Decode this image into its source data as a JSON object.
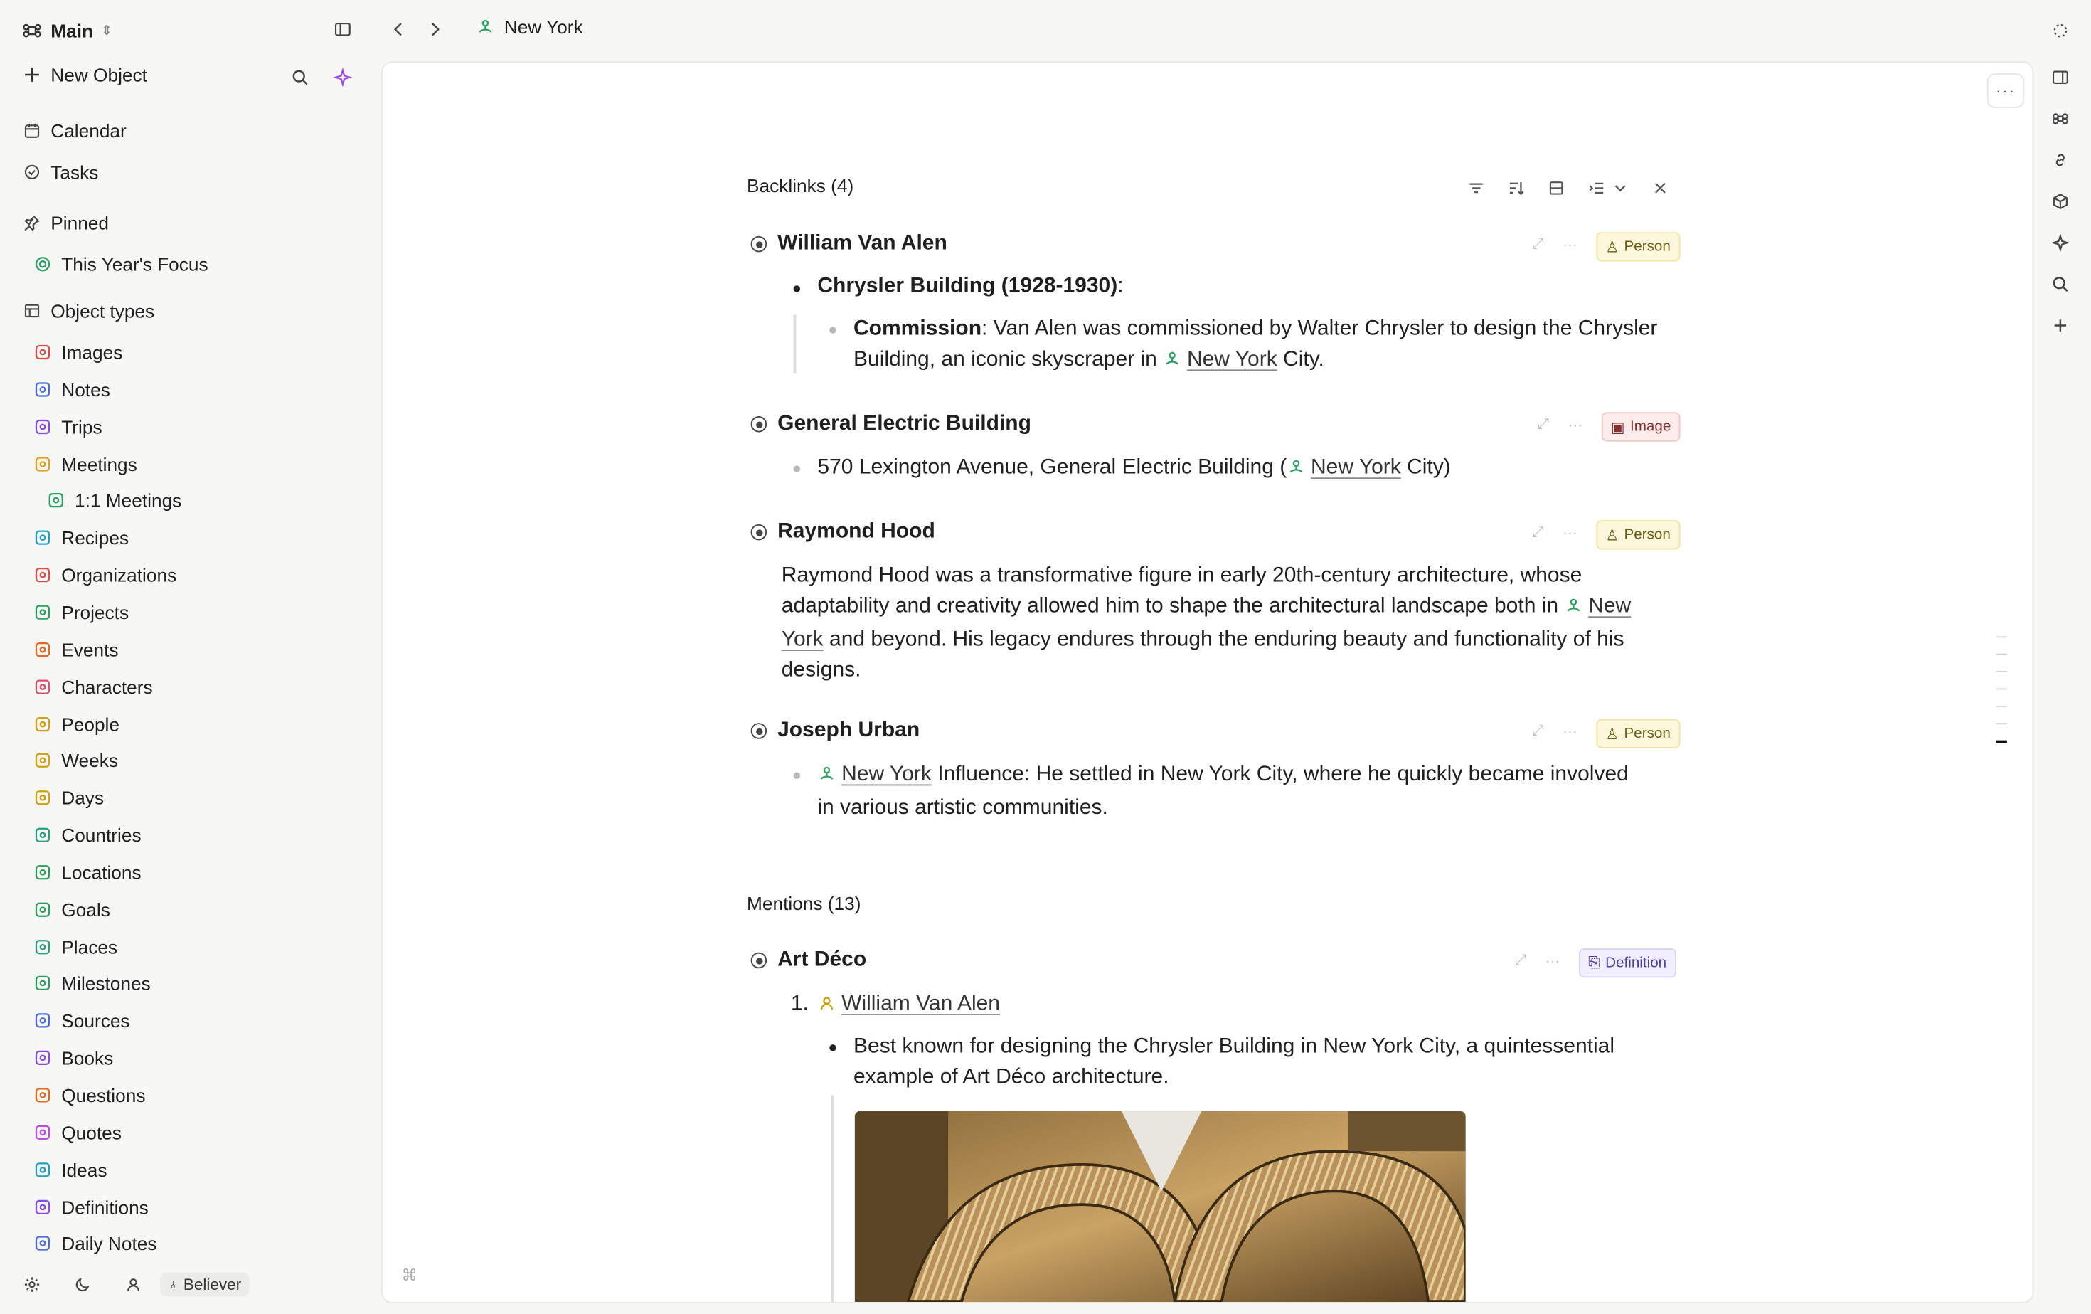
{
  "workspace": {
    "name": "Main"
  },
  "sidebar": {
    "new_object": "New Object",
    "top_items": [
      {
        "label": "Calendar",
        "icon": "calendar-icon"
      },
      {
        "label": "Tasks",
        "icon": "check-circle-icon"
      }
    ],
    "pinned_label": "Pinned",
    "pinned": [
      {
        "label": "This Year's Focus",
        "icon": "target-icon"
      }
    ],
    "object_types_label": "Object types",
    "object_types": [
      {
        "label": "Images",
        "icon": "image-icon",
        "color": "#e04c4c"
      },
      {
        "label": "Notes",
        "icon": "notes-icon",
        "color": "#4c6fe0"
      },
      {
        "label": "Trips",
        "icon": "luggage-icon",
        "color": "#8a4ce0"
      },
      {
        "label": "Meetings",
        "icon": "people-icon",
        "color": "#e0a020"
      },
      {
        "label": "1:1 Meetings",
        "icon": "meeting-list-icon",
        "color": "#2ba060",
        "sub": true
      },
      {
        "label": "Recipes",
        "icon": "chef-hat-icon",
        "color": "#20a0c0"
      },
      {
        "label": "Organizations",
        "icon": "building-icon",
        "color": "#e04c4c"
      },
      {
        "label": "Projects",
        "icon": "cube-icon",
        "color": "#2ba060"
      },
      {
        "label": "Events",
        "icon": "hourglass-icon",
        "color": "#e06a20"
      },
      {
        "label": "Characters",
        "icon": "character-icon",
        "color": "#e04c6a"
      },
      {
        "label": "People",
        "icon": "person-icon",
        "color": "#d0a010"
      },
      {
        "label": "Weeks",
        "icon": "sun-icon",
        "color": "#d0a010"
      },
      {
        "label": "Days",
        "icon": "sun-icon",
        "color": "#d0a010"
      },
      {
        "label": "Countries",
        "icon": "globe-icon",
        "color": "#2ba080"
      },
      {
        "label": "Locations",
        "icon": "location-icon",
        "color": "#2ba060"
      },
      {
        "label": "Goals",
        "icon": "target-icon",
        "color": "#2ba060"
      },
      {
        "label": "Places",
        "icon": "pin-icon",
        "color": "#2ba080"
      },
      {
        "label": "Milestones",
        "icon": "trophy-icon",
        "color": "#2ba060"
      },
      {
        "label": "Sources",
        "icon": "library-icon",
        "color": "#4c6fe0"
      },
      {
        "label": "Books",
        "icon": "book-icon",
        "color": "#8a4ce0"
      },
      {
        "label": "Questions",
        "icon": "question-icon",
        "color": "#e06a20"
      },
      {
        "label": "Quotes",
        "icon": "quote-icon",
        "color": "#c04ce0"
      },
      {
        "label": "Ideas",
        "icon": "bulb-icon",
        "color": "#20a0c0"
      },
      {
        "label": "Definitions",
        "icon": "bookmark-icon",
        "color": "#8a4ce0"
      },
      {
        "label": "Daily Notes",
        "icon": "calendar-icon",
        "color": "#4c6fe0"
      }
    ],
    "user_badge": "Believer"
  },
  "topbar": {
    "breadcrumb": "New York"
  },
  "backlinks": {
    "title": "Backlinks (4)",
    "entries": [
      {
        "title": "William Van Alen",
        "tag": "Person",
        "l1": "Chrysler Building (1928-1930)",
        "l1_suffix": ":",
        "l2_bold": "Commission",
        "l2_a": ": Van Alen was commissioned by Walter Chrysler to design the Chrysler",
        "l2_b": "Building, an iconic skyscraper in ",
        "l2_link": "New York",
        "l2_c": " City."
      },
      {
        "title": "General Electric Building",
        "tag": "Image",
        "l1_a": "570 Lexington Avenue, General Electric Building (",
        "l1_link": "New York",
        "l1_b": " City)"
      },
      {
        "title": "Raymond Hood",
        "tag": "Person",
        "p1": "Raymond Hood was a transformative figure in early 20th-century architecture, whose",
        "p2": "adaptability and creativity allowed him to shape the architectural landscape both in ",
        "p2_link": "New",
        "p3_link": "York",
        "p3": " and beyond. His legacy endures through the enduring beauty and functionality of his",
        "p4": "designs."
      },
      {
        "title": "Joseph Urban",
        "tag": "Person",
        "l1_link": "New York",
        "l1_a": " Influence: He settled in New York City, where he quickly became involved",
        "l1_b": "in various artistic communities."
      }
    ]
  },
  "mentions": {
    "title": "Mentions (13)",
    "entry": {
      "title": "Art Déco",
      "tag": "Definition",
      "num": "1.",
      "person_link": "William Van Alen",
      "b1": "Best known for designing the Chrysler Building in New York City, a quintessential",
      "b2": "example of Art Déco architecture."
    }
  }
}
